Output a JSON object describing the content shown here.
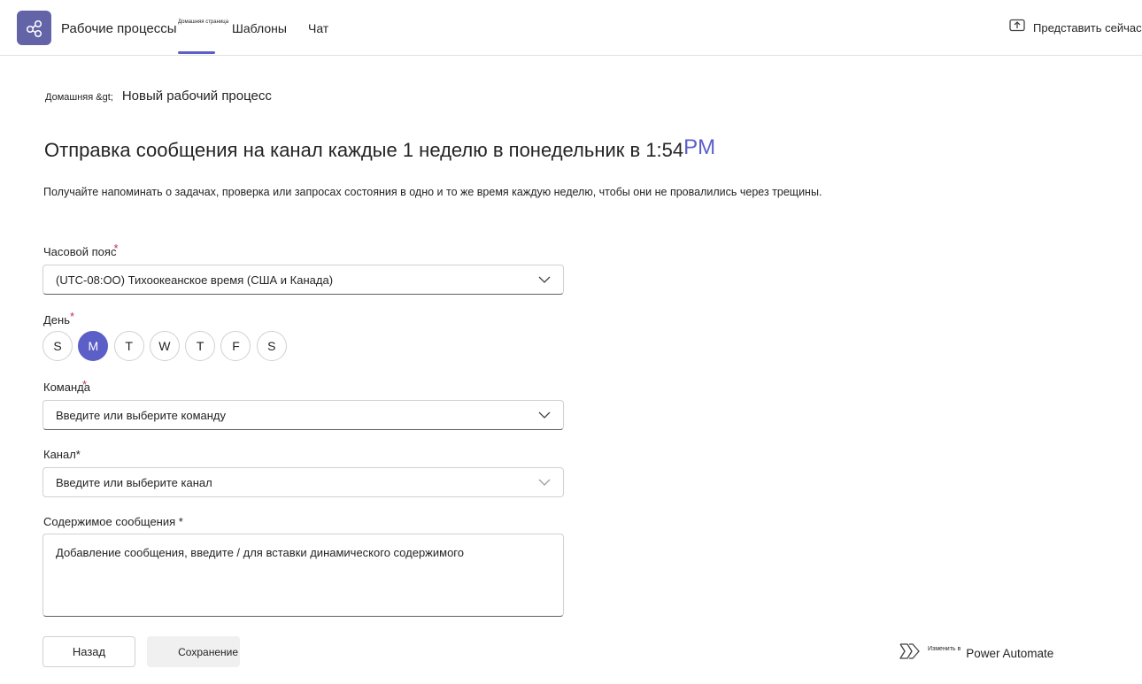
{
  "header": {
    "app_title": "Рабочие процессы",
    "tabs": {
      "home": "Домашняя страница",
      "templates": "Шаблоны",
      "chat": "Чат"
    },
    "present_label": "Представить сейчас",
    "accent_color": "#5b5fc7",
    "app_icon": "workflow-icon",
    "present_icon": "share-screen-icon"
  },
  "breadcrumb": {
    "home": "Домашняя &gt;",
    "current": "Новый рабочий процесс"
  },
  "page": {
    "title_main": "Отправка сообщения на канал каждые 1 неделю в понедельник в 1:54",
    "title_suffix": "PM",
    "description": "Получайте напоминать о задачах, проверка или запросах состояния в одно и то же время каждую неделю, чтобы они не провалились через трещины."
  },
  "form": {
    "timezone": {
      "label": "Часовой пояс",
      "required_mark": "*",
      "value": "(UTC-08:OO) Тихоокеанское время (США и Канада)"
    },
    "day": {
      "label": "День",
      "required_mark": "*",
      "options": [
        "S",
        "M",
        "T",
        "W",
        "T",
        "F",
        "S"
      ],
      "selected_index": 1
    },
    "team": {
      "label": "Команда",
      "required_mark": "*",
      "placeholder": "Введите или выберите команду"
    },
    "channel": {
      "label": "Канал*",
      "placeholder": "Введите или выберите канал"
    },
    "message": {
      "label": "Содержимое сообщения *",
      "placeholder": "Добавление сообщения, введите / для вставки динамического содержимого"
    }
  },
  "footer": {
    "back_label": "Назад",
    "save_label": "Сохранение",
    "edit_in_label": "Изменить в",
    "power_automate_label": "Power Automate",
    "power_automate_icon": "power-automate-icon"
  }
}
